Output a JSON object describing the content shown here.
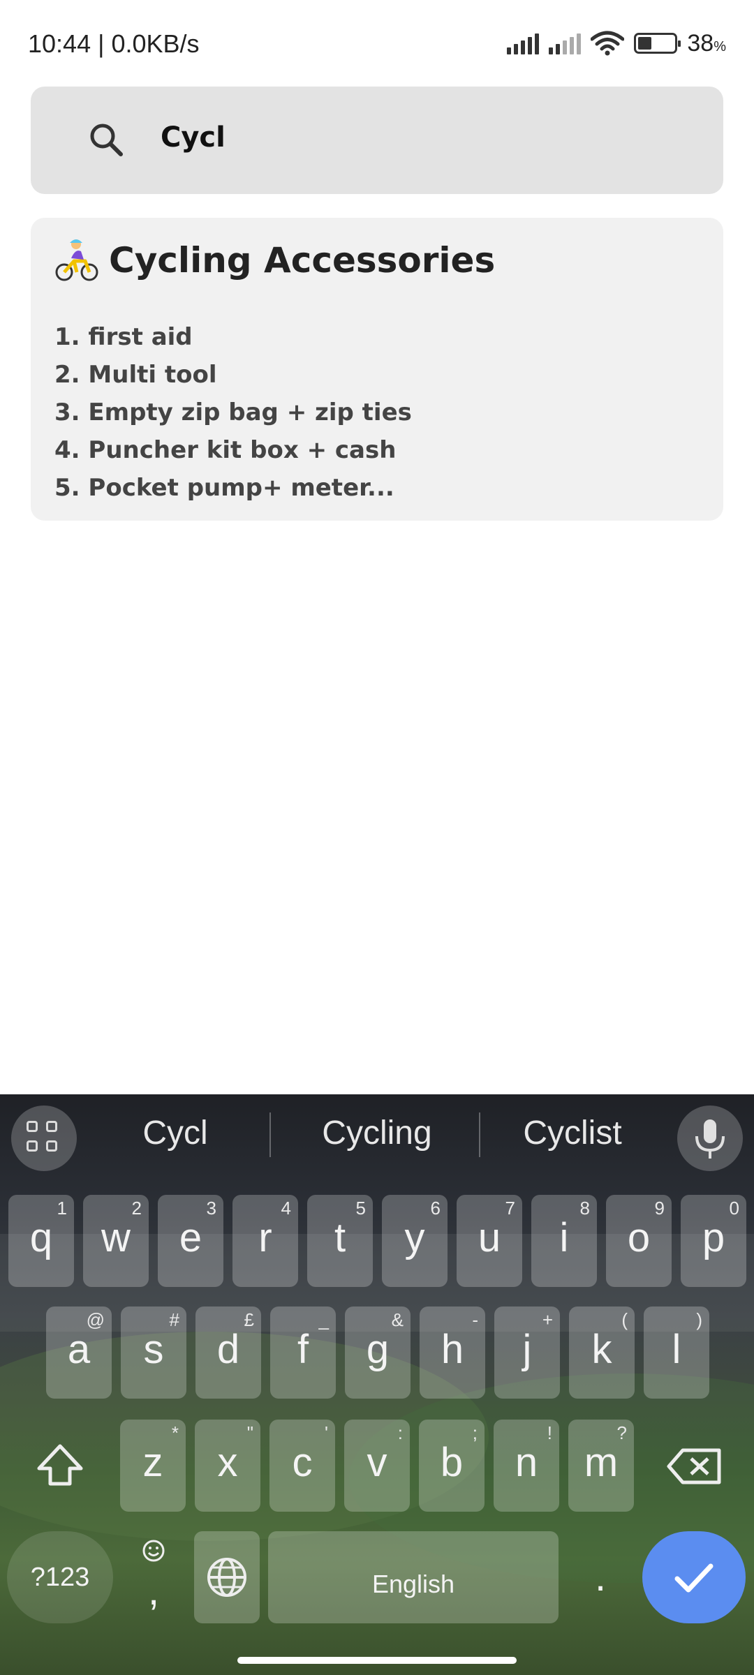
{
  "status_bar": {
    "time_speed": "10:44 | 0.0KB/s",
    "battery_percent": "38",
    "battery_unit": "%",
    "battery_level": 0.38
  },
  "search": {
    "query": "Cycl",
    "icon": "search-icon"
  },
  "note": {
    "emoji_icon": "woman-biking-icon",
    "title": "Cycling Accessories",
    "items": [
      "1. first aid",
      "2. Multi tool",
      "3. Empty zip bag + zip ties",
      "4. Puncher kit box + cash",
      "5. Pocket pump+ meter..."
    ]
  },
  "keyboard": {
    "suggestions": [
      "Cycl",
      "Cycling",
      "Cyclist"
    ],
    "row1": [
      {
        "k": "q",
        "h": "1"
      },
      {
        "k": "w",
        "h": "2"
      },
      {
        "k": "e",
        "h": "3"
      },
      {
        "k": "r",
        "h": "4"
      },
      {
        "k": "t",
        "h": "5"
      },
      {
        "k": "y",
        "h": "6"
      },
      {
        "k": "u",
        "h": "7"
      },
      {
        "k": "i",
        "h": "8"
      },
      {
        "k": "o",
        "h": "9"
      },
      {
        "k": "p",
        "h": "0"
      }
    ],
    "row2": [
      {
        "k": "a",
        "h": "@"
      },
      {
        "k": "s",
        "h": "#"
      },
      {
        "k": "d",
        "h": "£"
      },
      {
        "k": "f",
        "h": "_"
      },
      {
        "k": "g",
        "h": "&"
      },
      {
        "k": "h",
        "h": "-"
      },
      {
        "k": "j",
        "h": "+"
      },
      {
        "k": "k",
        "h": "("
      },
      {
        "k": "l",
        "h": ")"
      }
    ],
    "row3": [
      {
        "k": "z",
        "h": "*"
      },
      {
        "k": "x",
        "h": "\""
      },
      {
        "k": "c",
        "h": "'"
      },
      {
        "k": "v",
        "h": ":"
      },
      {
        "k": "b",
        "h": ";"
      },
      {
        "k": "n",
        "h": "!"
      },
      {
        "k": "m",
        "h": "?"
      }
    ],
    "symbols_label": "?123",
    "comma_label": ",",
    "space_label": "English",
    "period_label": ".",
    "colors": {
      "enter": "#5b8df0"
    }
  }
}
